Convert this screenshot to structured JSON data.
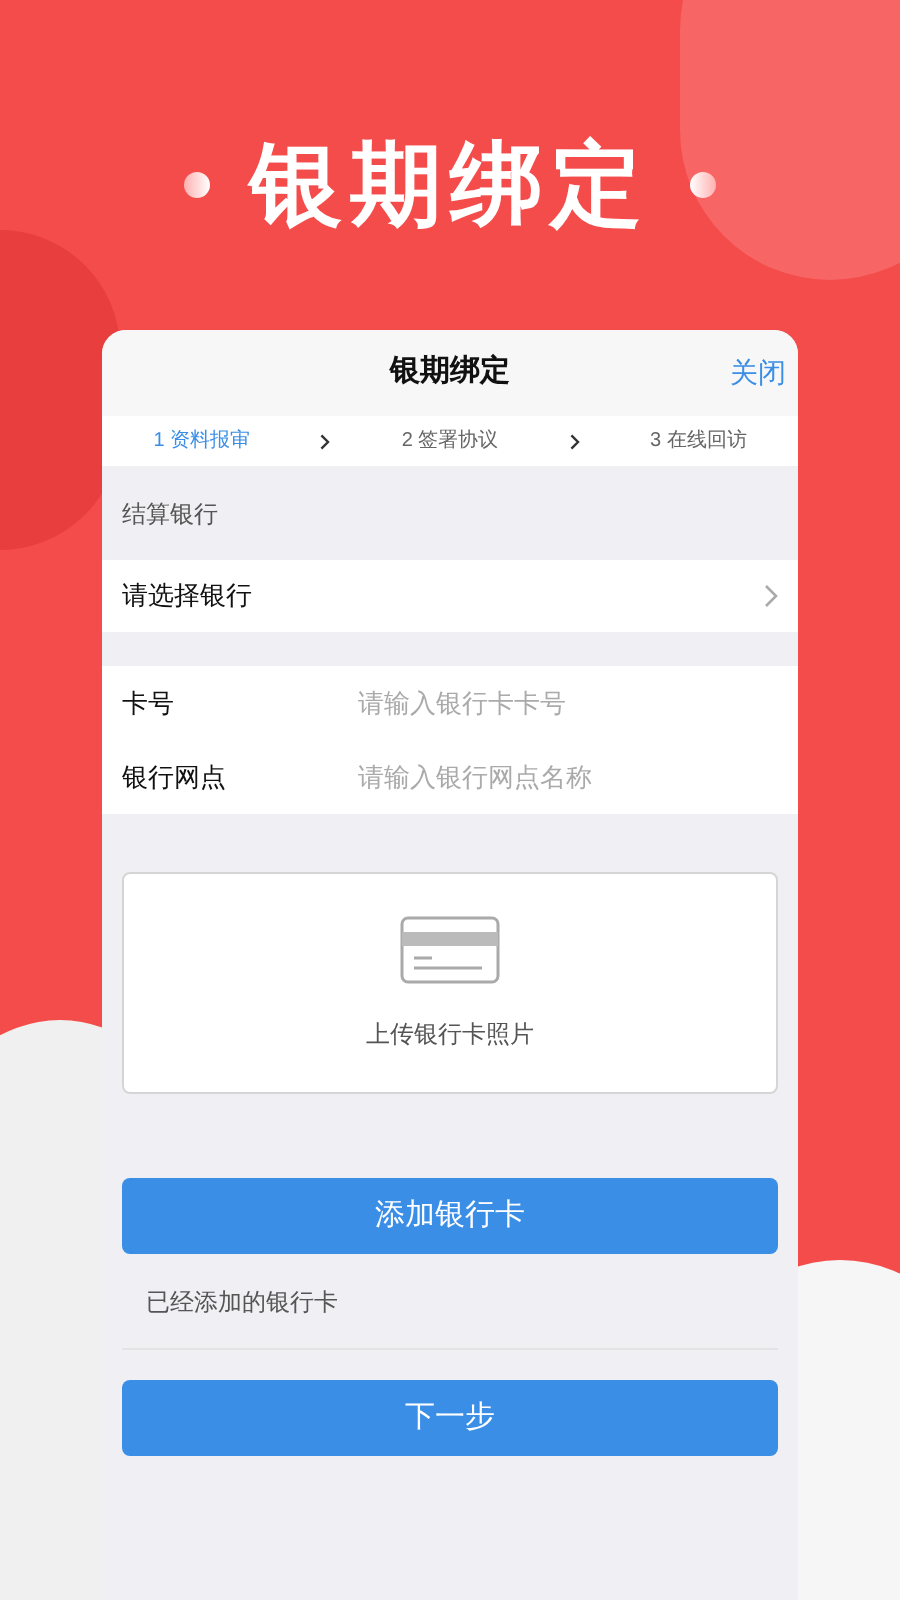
{
  "headline": "银期绑定",
  "nav": {
    "title": "银期绑定",
    "close": "关闭"
  },
  "steps": [
    {
      "label": "1 资料报审",
      "selected": true
    },
    {
      "label": "2 签署协议",
      "selected": false
    },
    {
      "label": "3 在线回访",
      "selected": false
    }
  ],
  "section_label": "结算银行",
  "bank_select": {
    "label": "请选择银行"
  },
  "fields": [
    {
      "label": "卡号",
      "placeholder": "请输入银行卡卡号"
    },
    {
      "label": "银行网点",
      "placeholder": "请输入银行网点名称"
    }
  ],
  "upload": {
    "label": "上传银行卡照片"
  },
  "add_button": "添加银行卡",
  "added_label": "已经添加的银行卡",
  "next_button": "下一步"
}
